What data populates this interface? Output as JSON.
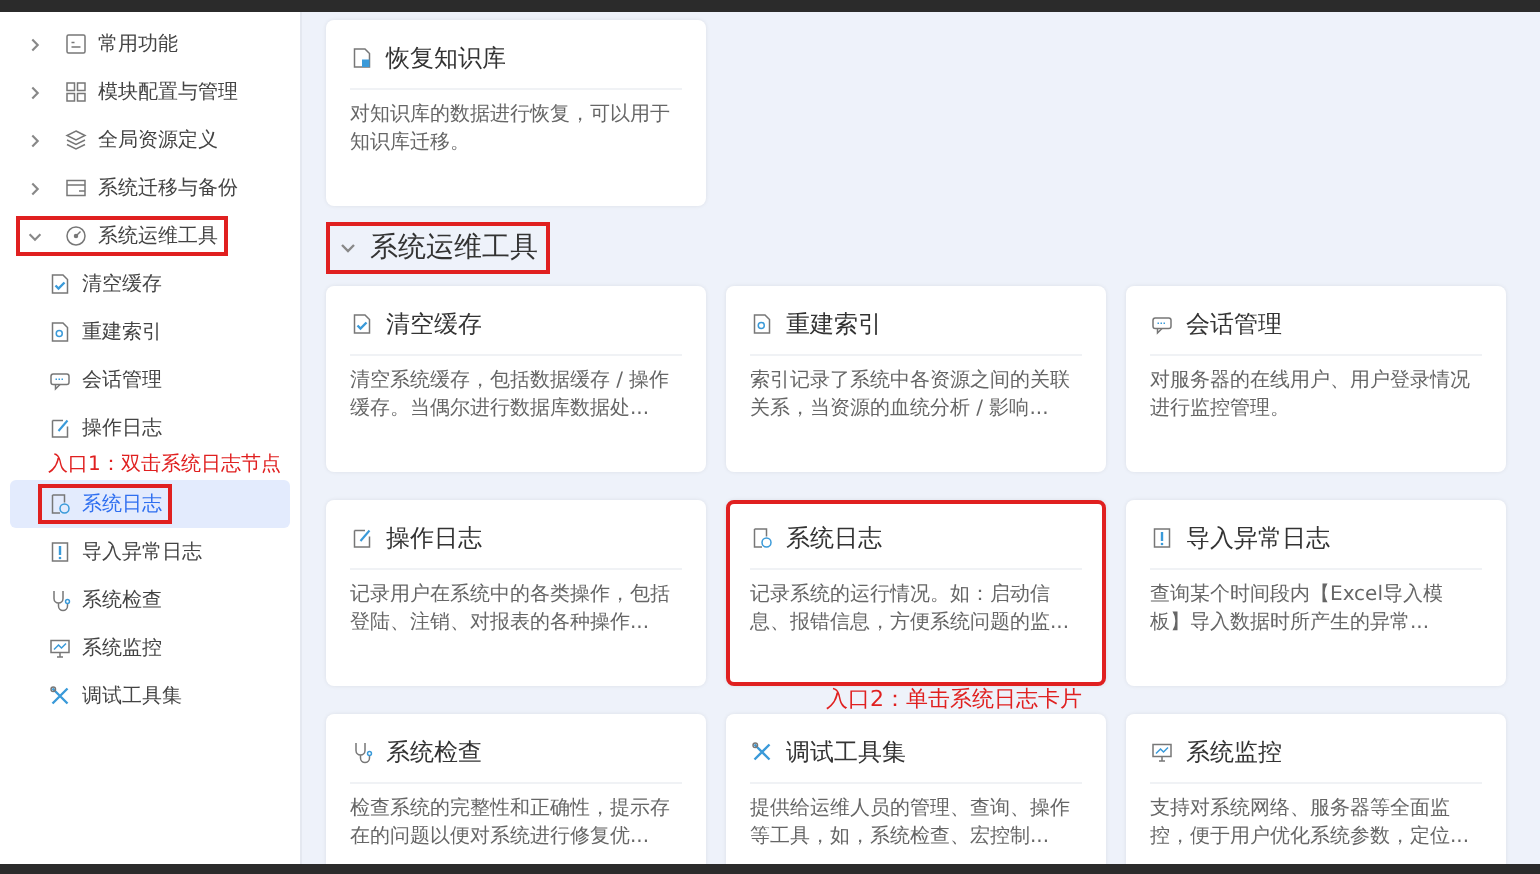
{
  "sidebar": {
    "items": [
      {
        "label": "常用功能",
        "expanded": false,
        "selected": false,
        "highlighted": false
      },
      {
        "label": "模块配置与管理",
        "expanded": false,
        "selected": false,
        "highlighted": false
      },
      {
        "label": "全局资源定义",
        "expanded": false,
        "selected": false,
        "highlighted": false
      },
      {
        "label": "系统迁移与备份",
        "expanded": false,
        "selected": false,
        "highlighted": false
      },
      {
        "label": "系统运维工具",
        "expanded": true,
        "selected": false,
        "highlighted": true,
        "children": [
          {
            "label": "清空缓存",
            "selected": false,
            "highlighted": false
          },
          {
            "label": "重建索引",
            "selected": false,
            "highlighted": false
          },
          {
            "label": "会话管理",
            "selected": false,
            "highlighted": false
          },
          {
            "label": "操作日志",
            "selected": false,
            "highlighted": false
          },
          {
            "label": "系统日志",
            "selected": true,
            "highlighted": true,
            "annotation": "入口1：双击系统日志节点"
          },
          {
            "label": "导入异常日志",
            "selected": false,
            "highlighted": false
          },
          {
            "label": "系统检查",
            "selected": false,
            "highlighted": false
          },
          {
            "label": "系统监控",
            "selected": false,
            "highlighted": false
          },
          {
            "label": "调试工具集",
            "selected": false,
            "highlighted": false
          }
        ]
      }
    ]
  },
  "content": {
    "cards_above": [
      {
        "title": "恢复知识库",
        "description": "对知识库的数据进行恢复，可以用于知识库迁移。",
        "highlighted": false
      }
    ],
    "section": {
      "title": "系统运维工具",
      "expanded": true,
      "highlighted": true,
      "cards": [
        {
          "title": "清空缓存",
          "description": "清空系统缓存，包括数据缓存 / 操作缓存。当偶尔进行数据库数据处...",
          "highlighted": false
        },
        {
          "title": "重建索引",
          "description": "索引记录了系统中各资源之间的关联关系，当资源的血统分析 / 影响...",
          "highlighted": false
        },
        {
          "title": "会话管理",
          "description": "对服务器的在线用户、用户登录情况进行监控管理。",
          "highlighted": false
        },
        {
          "title": "操作日志",
          "description": "记录用户在系统中的各类操作，包括登陆、注销、对报表的各种操作...",
          "highlighted": false
        },
        {
          "title": "系统日志",
          "description": "记录系统的运行情况。如：启动信息、报错信息，方便系统问题的监...",
          "highlighted": true,
          "annotation": "入口2：单击系统日志卡片"
        },
        {
          "title": "导入异常日志",
          "description": "查询某个时间段内【Excel导入模板】导入数据时所产生的异常...",
          "highlighted": false
        },
        {
          "title": "系统检查",
          "description": "检查系统的完整性和正确性，提示存在的问题以便对系统进行修复优...",
          "highlighted": false
        },
        {
          "title": "调试工具集",
          "description": "提供给运维人员的管理、查询、操作等工具，如，系统检查、宏控制...",
          "highlighted": false
        },
        {
          "title": "系统监控",
          "description": "支持对系统网络、服务器等全面监控，便于用户优化系统参数，定位...",
          "highlighted": false
        }
      ]
    }
  }
}
